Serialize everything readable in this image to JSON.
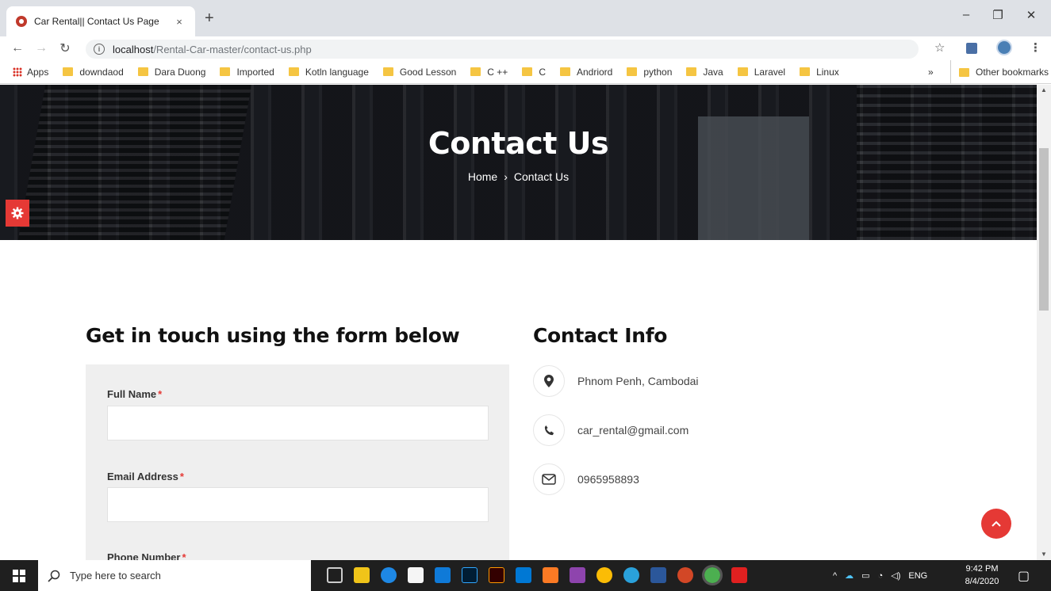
{
  "browser": {
    "tab_title": "Car Rental|| Contact Us Page",
    "tab_close": "×",
    "new_tab": "+",
    "url_host": "localhost",
    "url_path": "/Rental-Car-master/contact-us.php",
    "win_min": "–",
    "win_max": "❐",
    "win_close": "✕"
  },
  "bookmarks": {
    "apps": "Apps",
    "items": [
      "downdaod",
      "Dara Duong",
      "Imported",
      "Kotln language",
      "Good Lesson",
      "C ++",
      "C",
      "Andriord",
      "python",
      "Java",
      "Laravel",
      "Linux"
    ],
    "overflow": "»",
    "other": "Other bookmarks"
  },
  "hero": {
    "title": "Contact Us",
    "crumb_home": "Home",
    "crumb_sep": "›",
    "crumb_current": "Contact Us"
  },
  "form": {
    "heading": "Get in touch using the form below",
    "full_name_label": "Full Name",
    "email_label": "Email Address",
    "phone_label": "Phone Number",
    "required_mark": "*"
  },
  "contact": {
    "heading": "Contact Info",
    "address": "Phnom Penh, Cambodai",
    "email": "car_rental@gmail.com",
    "phone": "0965958893"
  },
  "taskbar": {
    "search_placeholder": "Type here to search",
    "language": "ENG",
    "time": "9:42 PM",
    "date": "8/4/2020"
  },
  "colors": {
    "accent": "#e53935",
    "form_bg": "#efefef",
    "taskbar": "#1f1f1f"
  }
}
